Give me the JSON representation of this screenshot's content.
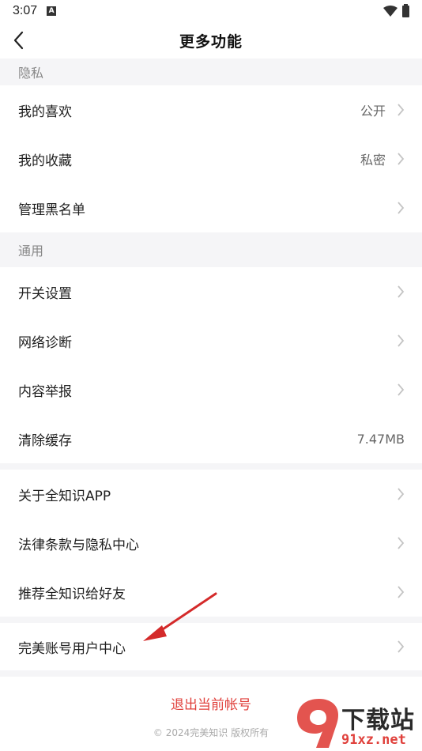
{
  "status_bar": {
    "time": "3:07",
    "a_icon": "A"
  },
  "nav": {
    "title": "更多功能"
  },
  "sections": {
    "privacy": {
      "header": "隐私",
      "items": [
        {
          "label": "我的喜欢",
          "value": "公开"
        },
        {
          "label": "我的收藏",
          "value": "私密"
        },
        {
          "label": "管理黑名单"
        }
      ]
    },
    "general": {
      "header": "通用",
      "items": [
        {
          "label": "开关设置"
        },
        {
          "label": "网络诊断"
        },
        {
          "label": "内容举报"
        },
        {
          "label": "清除缓存",
          "value": "7.47MB"
        }
      ]
    },
    "about": {
      "items": [
        {
          "label": "关于全知识APP"
        },
        {
          "label": "法律条款与隐私中心"
        },
        {
          "label": "推荐全知识给好友"
        }
      ]
    },
    "account": {
      "items": [
        {
          "label": "完美账号用户中心"
        }
      ]
    }
  },
  "logout_label": "退出当前帐号",
  "copyright": "© 2024完美知识 版权所有",
  "watermark": {
    "title": "下载站",
    "domain": "91xz.net"
  },
  "colors": {
    "accent_red": "#e0413c",
    "section_bg": "#f5f5f7"
  }
}
